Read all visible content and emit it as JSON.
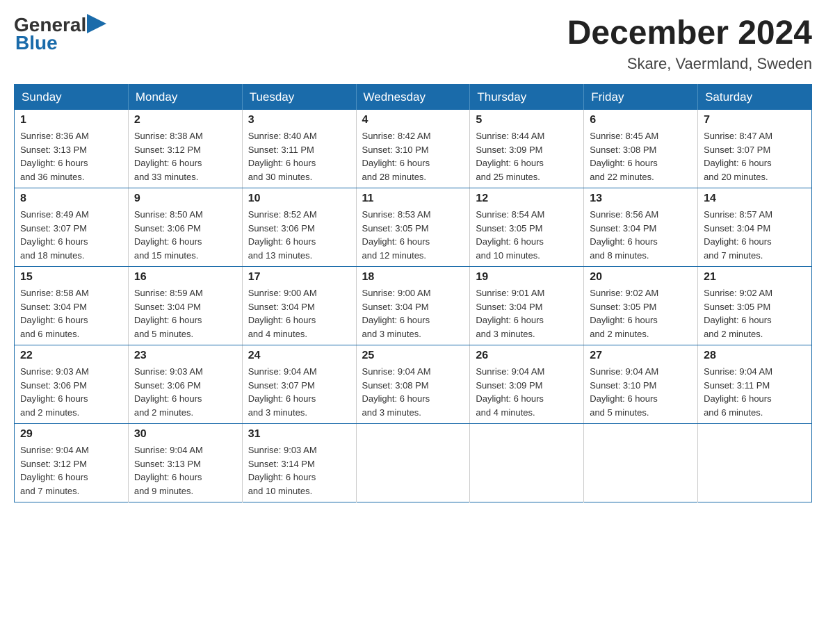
{
  "header": {
    "logo_general": "General",
    "logo_blue": "Blue",
    "month_title": "December 2024",
    "location": "Skare, Vaermland, Sweden"
  },
  "calendar": {
    "days_of_week": [
      "Sunday",
      "Monday",
      "Tuesday",
      "Wednesday",
      "Thursday",
      "Friday",
      "Saturday"
    ],
    "weeks": [
      [
        {
          "day": "1",
          "info": "Sunrise: 8:36 AM\nSunset: 3:13 PM\nDaylight: 6 hours\nand 36 minutes."
        },
        {
          "day": "2",
          "info": "Sunrise: 8:38 AM\nSunset: 3:12 PM\nDaylight: 6 hours\nand 33 minutes."
        },
        {
          "day": "3",
          "info": "Sunrise: 8:40 AM\nSunset: 3:11 PM\nDaylight: 6 hours\nand 30 minutes."
        },
        {
          "day": "4",
          "info": "Sunrise: 8:42 AM\nSunset: 3:10 PM\nDaylight: 6 hours\nand 28 minutes."
        },
        {
          "day": "5",
          "info": "Sunrise: 8:44 AM\nSunset: 3:09 PM\nDaylight: 6 hours\nand 25 minutes."
        },
        {
          "day": "6",
          "info": "Sunrise: 8:45 AM\nSunset: 3:08 PM\nDaylight: 6 hours\nand 22 minutes."
        },
        {
          "day": "7",
          "info": "Sunrise: 8:47 AM\nSunset: 3:07 PM\nDaylight: 6 hours\nand 20 minutes."
        }
      ],
      [
        {
          "day": "8",
          "info": "Sunrise: 8:49 AM\nSunset: 3:07 PM\nDaylight: 6 hours\nand 18 minutes."
        },
        {
          "day": "9",
          "info": "Sunrise: 8:50 AM\nSunset: 3:06 PM\nDaylight: 6 hours\nand 15 minutes."
        },
        {
          "day": "10",
          "info": "Sunrise: 8:52 AM\nSunset: 3:06 PM\nDaylight: 6 hours\nand 13 minutes."
        },
        {
          "day": "11",
          "info": "Sunrise: 8:53 AM\nSunset: 3:05 PM\nDaylight: 6 hours\nand 12 minutes."
        },
        {
          "day": "12",
          "info": "Sunrise: 8:54 AM\nSunset: 3:05 PM\nDaylight: 6 hours\nand 10 minutes."
        },
        {
          "day": "13",
          "info": "Sunrise: 8:56 AM\nSunset: 3:04 PM\nDaylight: 6 hours\nand 8 minutes."
        },
        {
          "day": "14",
          "info": "Sunrise: 8:57 AM\nSunset: 3:04 PM\nDaylight: 6 hours\nand 7 minutes."
        }
      ],
      [
        {
          "day": "15",
          "info": "Sunrise: 8:58 AM\nSunset: 3:04 PM\nDaylight: 6 hours\nand 6 minutes."
        },
        {
          "day": "16",
          "info": "Sunrise: 8:59 AM\nSunset: 3:04 PM\nDaylight: 6 hours\nand 5 minutes."
        },
        {
          "day": "17",
          "info": "Sunrise: 9:00 AM\nSunset: 3:04 PM\nDaylight: 6 hours\nand 4 minutes."
        },
        {
          "day": "18",
          "info": "Sunrise: 9:00 AM\nSunset: 3:04 PM\nDaylight: 6 hours\nand 3 minutes."
        },
        {
          "day": "19",
          "info": "Sunrise: 9:01 AM\nSunset: 3:04 PM\nDaylight: 6 hours\nand 3 minutes."
        },
        {
          "day": "20",
          "info": "Sunrise: 9:02 AM\nSunset: 3:05 PM\nDaylight: 6 hours\nand 2 minutes."
        },
        {
          "day": "21",
          "info": "Sunrise: 9:02 AM\nSunset: 3:05 PM\nDaylight: 6 hours\nand 2 minutes."
        }
      ],
      [
        {
          "day": "22",
          "info": "Sunrise: 9:03 AM\nSunset: 3:06 PM\nDaylight: 6 hours\nand 2 minutes."
        },
        {
          "day": "23",
          "info": "Sunrise: 9:03 AM\nSunset: 3:06 PM\nDaylight: 6 hours\nand 2 minutes."
        },
        {
          "day": "24",
          "info": "Sunrise: 9:04 AM\nSunset: 3:07 PM\nDaylight: 6 hours\nand 3 minutes."
        },
        {
          "day": "25",
          "info": "Sunrise: 9:04 AM\nSunset: 3:08 PM\nDaylight: 6 hours\nand 3 minutes."
        },
        {
          "day": "26",
          "info": "Sunrise: 9:04 AM\nSunset: 3:09 PM\nDaylight: 6 hours\nand 4 minutes."
        },
        {
          "day": "27",
          "info": "Sunrise: 9:04 AM\nSunset: 3:10 PM\nDaylight: 6 hours\nand 5 minutes."
        },
        {
          "day": "28",
          "info": "Sunrise: 9:04 AM\nSunset: 3:11 PM\nDaylight: 6 hours\nand 6 minutes."
        }
      ],
      [
        {
          "day": "29",
          "info": "Sunrise: 9:04 AM\nSunset: 3:12 PM\nDaylight: 6 hours\nand 7 minutes."
        },
        {
          "day": "30",
          "info": "Sunrise: 9:04 AM\nSunset: 3:13 PM\nDaylight: 6 hours\nand 9 minutes."
        },
        {
          "day": "31",
          "info": "Sunrise: 9:03 AM\nSunset: 3:14 PM\nDaylight: 6 hours\nand 10 minutes."
        },
        null,
        null,
        null,
        null
      ]
    ]
  }
}
